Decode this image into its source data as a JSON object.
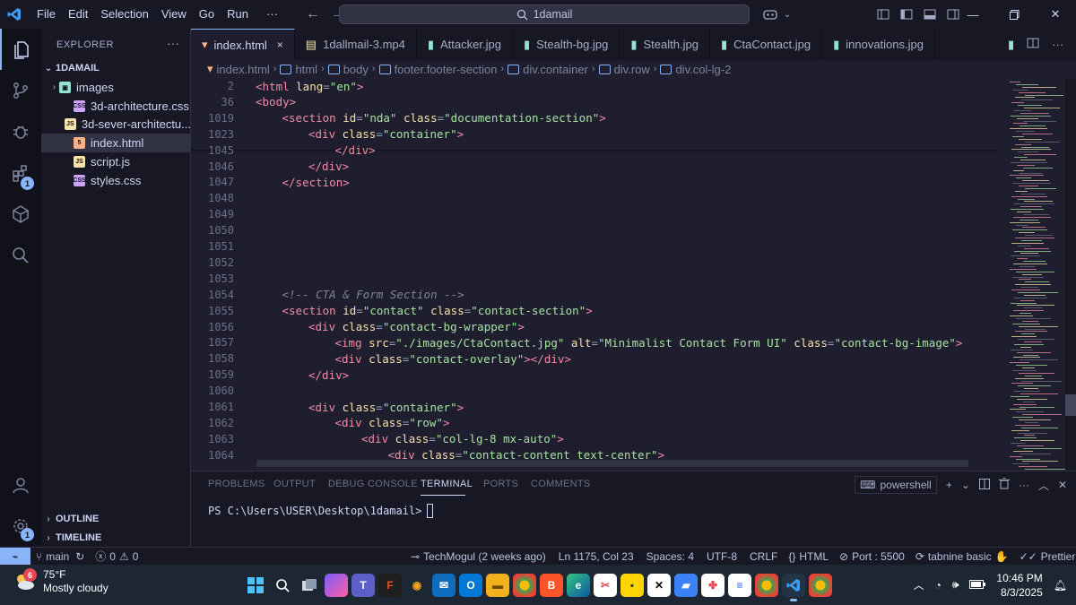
{
  "titlebar": {
    "menus": [
      "File",
      "Edit",
      "Selection",
      "View",
      "Go",
      "Run"
    ],
    "more": "···",
    "search": "1damail"
  },
  "explorer": {
    "title": "EXPLORER",
    "more": "···",
    "root": "1DAMAIL",
    "items": [
      {
        "label": "images",
        "type": "folder"
      },
      {
        "label": "3d-architecture.css",
        "type": "css"
      },
      {
        "label": "3d-sever-architectu...",
        "type": "js"
      },
      {
        "label": "index.html",
        "type": "html"
      },
      {
        "label": "script.js",
        "type": "js"
      },
      {
        "label": "styles.css",
        "type": "css"
      }
    ],
    "outline": "OUTLINE",
    "timeline": "TIMELINE"
  },
  "activity": {
    "extensions_badge": "1",
    "settings_badge": "1"
  },
  "tabs": [
    {
      "label": "index.html",
      "icon": "html-icon",
      "active": true,
      "close": "×"
    },
    {
      "label": "1dallmail-3.mp4",
      "icon": "video-icon"
    },
    {
      "label": "Attacker.jpg",
      "icon": "image-icon"
    },
    {
      "label": "Stealth-bg.jpg",
      "icon": "image-icon"
    },
    {
      "label": "Stealth.jpg",
      "icon": "image-icon"
    },
    {
      "label": "CtaContact.jpg",
      "icon": "image-icon"
    },
    {
      "label": "innovations.jpg",
      "icon": "image-icon"
    }
  ],
  "breadcrumb": [
    "index.html",
    "html",
    "body",
    "footer.footer-section",
    "div.container",
    "div.row",
    "div.col-lg-2"
  ],
  "code": {
    "lines": [
      {
        "n": "2",
        "tokens": [
          [
            "tag",
            "<html "
          ],
          [
            "attr",
            "lang"
          ],
          [
            "punc",
            "="
          ],
          [
            "str",
            "\"en\""
          ],
          [
            "tag",
            ">"
          ]
        ],
        "indent": 0
      },
      {
        "n": "36",
        "tokens": [
          [
            "tag",
            "<body>"
          ]
        ],
        "indent": 0
      },
      {
        "n": "1019",
        "tokens": [
          [
            "tag",
            "<section "
          ],
          [
            "attr",
            "id"
          ],
          [
            "punc",
            "="
          ],
          [
            "str",
            "\"nda\" "
          ],
          [
            "attr",
            "class"
          ],
          [
            "punc",
            "="
          ],
          [
            "str",
            "\"documentation-section\""
          ],
          [
            "tag",
            ">"
          ]
        ],
        "indent": 1
      },
      {
        "n": "1023",
        "tokens": [
          [
            "tag",
            "<div "
          ],
          [
            "attr",
            "class"
          ],
          [
            "punc",
            "="
          ],
          [
            "str",
            "\"container\""
          ],
          [
            "tag",
            ">"
          ]
        ],
        "indent": 2
      },
      {
        "n": "1045",
        "tokens": [
          [
            "tag",
            "</div>"
          ]
        ],
        "indent": 3
      },
      {
        "n": "1046",
        "tokens": [
          [
            "tag",
            "</div>"
          ]
        ],
        "indent": 2
      },
      {
        "n": "1047",
        "tokens": [
          [
            "tag",
            "</section>"
          ]
        ],
        "indent": 1
      },
      {
        "n": "1048",
        "tokens": [],
        "indent": 0
      },
      {
        "n": "1049",
        "tokens": [],
        "indent": 0
      },
      {
        "n": "1050",
        "tokens": [],
        "indent": 0
      },
      {
        "n": "1051",
        "tokens": [],
        "indent": 0
      },
      {
        "n": "1052",
        "tokens": [],
        "indent": 0
      },
      {
        "n": "1053",
        "tokens": [],
        "indent": 0
      },
      {
        "n": "1054",
        "tokens": [
          [
            "com",
            "<!-- CTA & Form Section -->"
          ]
        ],
        "indent": 1
      },
      {
        "n": "1055",
        "tokens": [
          [
            "tag",
            "<section "
          ],
          [
            "attr",
            "id"
          ],
          [
            "punc",
            "="
          ],
          [
            "str",
            "\"contact\" "
          ],
          [
            "attr",
            "class"
          ],
          [
            "punc",
            "="
          ],
          [
            "str",
            "\"contact-section\""
          ],
          [
            "tag",
            ">"
          ]
        ],
        "indent": 1
      },
      {
        "n": "1056",
        "tokens": [
          [
            "tag",
            "<div "
          ],
          [
            "attr",
            "class"
          ],
          [
            "punc",
            "="
          ],
          [
            "str",
            "\"contact-bg-wrapper\""
          ],
          [
            "tag",
            ">"
          ]
        ],
        "indent": 2
      },
      {
        "n": "1057",
        "tokens": [
          [
            "tag",
            "<img "
          ],
          [
            "attr",
            "src"
          ],
          [
            "punc",
            "="
          ],
          [
            "str",
            "\"./images/CtaContact.jpg\" "
          ],
          [
            "attr",
            "alt"
          ],
          [
            "punc",
            "="
          ],
          [
            "str",
            "\"Minimalist Contact Form UI\" "
          ],
          [
            "attr",
            "class"
          ],
          [
            "punc",
            "="
          ],
          [
            "str",
            "\"contact-bg-image\""
          ],
          [
            "tag",
            ">"
          ]
        ],
        "indent": 3
      },
      {
        "n": "1058",
        "tokens": [
          [
            "tag",
            "<div "
          ],
          [
            "attr",
            "class"
          ],
          [
            "punc",
            "="
          ],
          [
            "str",
            "\"contact-overlay\""
          ],
          [
            "tag",
            "></div>"
          ]
        ],
        "indent": 3
      },
      {
        "n": "1059",
        "tokens": [
          [
            "tag",
            "</div>"
          ]
        ],
        "indent": 2
      },
      {
        "n": "1060",
        "tokens": [],
        "indent": 0
      },
      {
        "n": "1061",
        "tokens": [
          [
            "tag",
            "<div "
          ],
          [
            "attr",
            "class"
          ],
          [
            "punc",
            "="
          ],
          [
            "str",
            "\"container\""
          ],
          [
            "tag",
            ">"
          ]
        ],
        "indent": 2
      },
      {
        "n": "1062",
        "tokens": [
          [
            "tag",
            "<div "
          ],
          [
            "attr",
            "class"
          ],
          [
            "punc",
            "="
          ],
          [
            "str",
            "\"row\""
          ],
          [
            "tag",
            ">"
          ]
        ],
        "indent": 3
      },
      {
        "n": "1063",
        "tokens": [
          [
            "tag",
            "<div "
          ],
          [
            "attr",
            "class"
          ],
          [
            "punc",
            "="
          ],
          [
            "str",
            "\"col-lg-8 mx-auto\""
          ],
          [
            "tag",
            ">"
          ]
        ],
        "indent": 4
      },
      {
        "n": "1064",
        "tokens": [
          [
            "tag",
            "<div "
          ],
          [
            "attr",
            "class"
          ],
          [
            "punc",
            "="
          ],
          [
            "str",
            "\"contact-content text-center\""
          ],
          [
            "tag",
            ">"
          ]
        ],
        "indent": 5
      }
    ]
  },
  "panel": {
    "tabs": [
      "PROBLEMS",
      "OUTPUT",
      "DEBUG CONSOLE",
      "TERMINAL",
      "PORTS",
      "COMMENTS"
    ],
    "active_tab": "TERMINAL",
    "shell": "powershell",
    "prompt": "PS C:\\Users\\USER\\Desktop\\1damail>"
  },
  "status": {
    "branch": "main",
    "errors": "0",
    "warnings": "0",
    "blame": "TechMogul (2 weeks ago)",
    "position": "Ln 1175, Col 23",
    "spaces": "Spaces: 4",
    "encoding": "UTF-8",
    "eol": "CRLF",
    "language": "HTML",
    "port": "Port : 5500",
    "tabnine": "tabnine basic",
    "prettier": "Prettier"
  },
  "taskbar": {
    "weather_badge": "6",
    "temp": "75°F",
    "condition": "Mostly cloudy",
    "time": "10:46 PM",
    "date": "8/3/2025"
  },
  "colors": {
    "accent": "#89b4fa",
    "tag": "#f38ba8",
    "attr": "#f9e2af",
    "string": "#a6e3a1"
  }
}
